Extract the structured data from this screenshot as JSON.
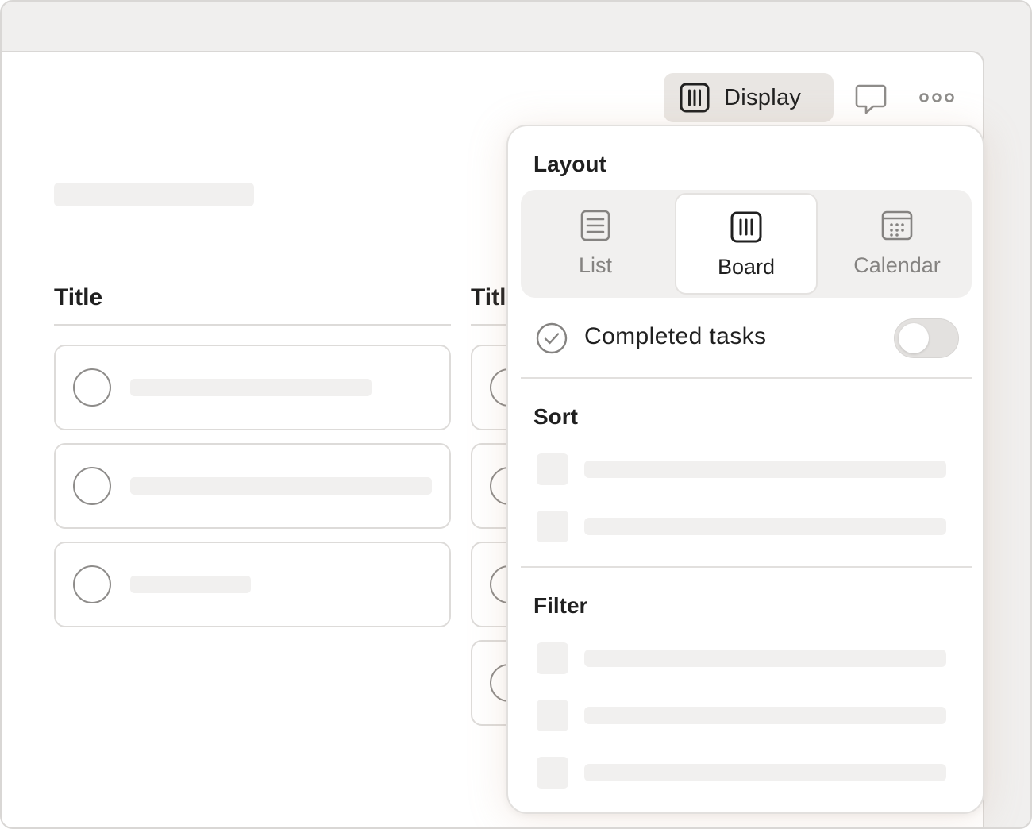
{
  "toolbar": {
    "display_label": "Display",
    "display_icon": "board-icon",
    "comment_icon": "comment-icon",
    "more_icon": "more-options-icon"
  },
  "board": {
    "columns": [
      {
        "title": "Title",
        "cards": 3
      },
      {
        "title": "Title",
        "cards": 4
      }
    ]
  },
  "popover": {
    "layout": {
      "title": "Layout",
      "options": [
        {
          "label": "List",
          "icon": "list-icon",
          "selected": false
        },
        {
          "label": "Board",
          "icon": "board-icon",
          "selected": true
        },
        {
          "label": "Calendar",
          "icon": "calendar-icon",
          "selected": false
        }
      ]
    },
    "completed_tasks": {
      "label": "Completed tasks",
      "enabled": false
    },
    "sort": {
      "title": "Sort"
    },
    "filter": {
      "title": "Filter"
    }
  },
  "colors": {
    "background": "#f0efee",
    "accent_surface": "#e9e6e3",
    "text": "#202020",
    "muted": "#858381",
    "skeleton": "#f1f0ef"
  }
}
